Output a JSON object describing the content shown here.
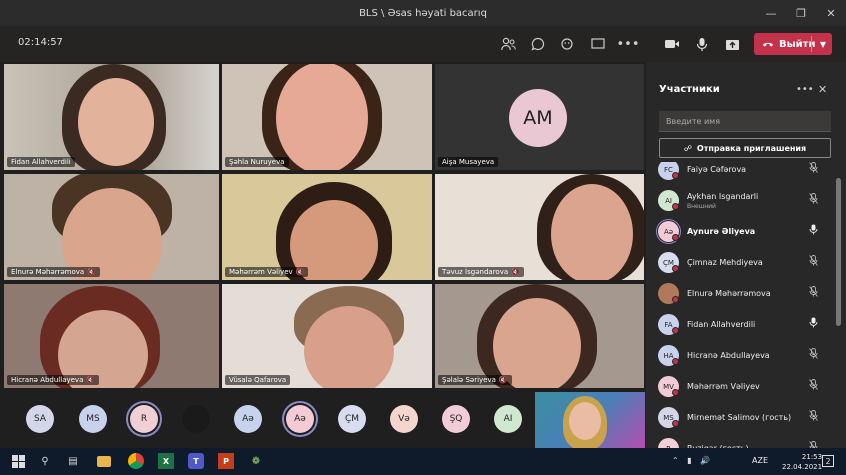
{
  "window": {
    "title": "BLS \\ Əsas həyati bacarıq"
  },
  "toolbar": {
    "timer": "02:14:57",
    "leave_label": "Выйти"
  },
  "tiles": [
    {
      "name": "Fidan Allahverdili",
      "muted": false
    },
    {
      "name": "Şəhla Nuruyeva",
      "muted": false
    },
    {
      "name": "Aişa Musayeva",
      "muted": false,
      "initials": "AM"
    },
    {
      "name": "Elnurə Məhərrəmova",
      "muted": true
    },
    {
      "name": "Məhərrəm Vəliyev",
      "muted": true
    },
    {
      "name": "Təvuz İsgəndarova",
      "muted": true
    },
    {
      "name": "Hicranə Abdullayeva",
      "muted": true
    },
    {
      "name": "Vüsalə Qafarova",
      "muted": false
    },
    {
      "name": "Şəlalə Səriyeva",
      "muted": true
    }
  ],
  "strip_avatars": [
    {
      "initials": "SA",
      "color": "#d2d6e8"
    },
    {
      "initials": "MS",
      "color": "#c9d2ec"
    },
    {
      "initials": "R",
      "color": "#f1d0d5"
    },
    {
      "initials": "",
      "color": "#1a1a1a"
    },
    {
      "initials": "Aə",
      "color": "#c7d3ee"
    },
    {
      "initials": "Aə",
      "color": "#f2cbd5"
    },
    {
      "initials": "ÇM",
      "color": "#d7dcef"
    },
    {
      "initials": "Və",
      "color": "#f5d6cf"
    },
    {
      "initials": "ŞQ",
      "color": "#f2ccd7"
    },
    {
      "initials": "AI",
      "color": "#d0e8cf"
    }
  ],
  "panel": {
    "title": "Участники",
    "search_placeholder": "Введите имя",
    "invite_label": "Отправка приглашения",
    "participants": [
      {
        "name": "Faiyə Cəfərova",
        "initials": "FC",
        "color": "#c8d2ec",
        "sub": "",
        "bold": false,
        "mic": "muted"
      },
      {
        "name": "Aykhan Isgandarli",
        "initials": "AI",
        "color": "#d0e8cf",
        "sub": "Внешний",
        "bold": false,
        "mic": "muted"
      },
      {
        "name": "Aynurə Əliyeva",
        "initials": "Aə",
        "color": "#f2cbd5",
        "sub": "",
        "bold": true,
        "mic": "on"
      },
      {
        "name": "Çimnaz Mehdiyeva",
        "initials": "ÇM",
        "color": "#d7dcef",
        "sub": "",
        "bold": false,
        "mic": "muted"
      },
      {
        "name": "Elnurə Məhərrəmova",
        "initials": "",
        "color": "#b07a5a",
        "sub": "",
        "bold": false,
        "mic": "muted"
      },
      {
        "name": "Fidan Allahverdili",
        "initials": "FA",
        "color": "#c9d2ec",
        "sub": "",
        "bold": false,
        "mic": "on"
      },
      {
        "name": "Hicranə Abdullayeva",
        "initials": "HA",
        "color": "#c9d2ec",
        "sub": "",
        "bold": false,
        "mic": "muted"
      },
      {
        "name": "Məhərrəm Vəliyev",
        "initials": "MV",
        "color": "#f2cbd5",
        "sub": "",
        "bold": false,
        "mic": "muted"
      },
      {
        "name": "Mirnemət Salimov (гость)",
        "initials": "MS",
        "color": "#d2d6e8",
        "sub": "",
        "bold": false,
        "mic": "muted"
      },
      {
        "name": "Ruzigar (гость)",
        "initials": "R",
        "color": "#f1d0d5",
        "sub": "",
        "bold": false,
        "mic": "muted"
      }
    ]
  },
  "taskbar": {
    "lang": "AZE",
    "time": "21:53",
    "date": "22.04.2021",
    "notifications": "2"
  }
}
